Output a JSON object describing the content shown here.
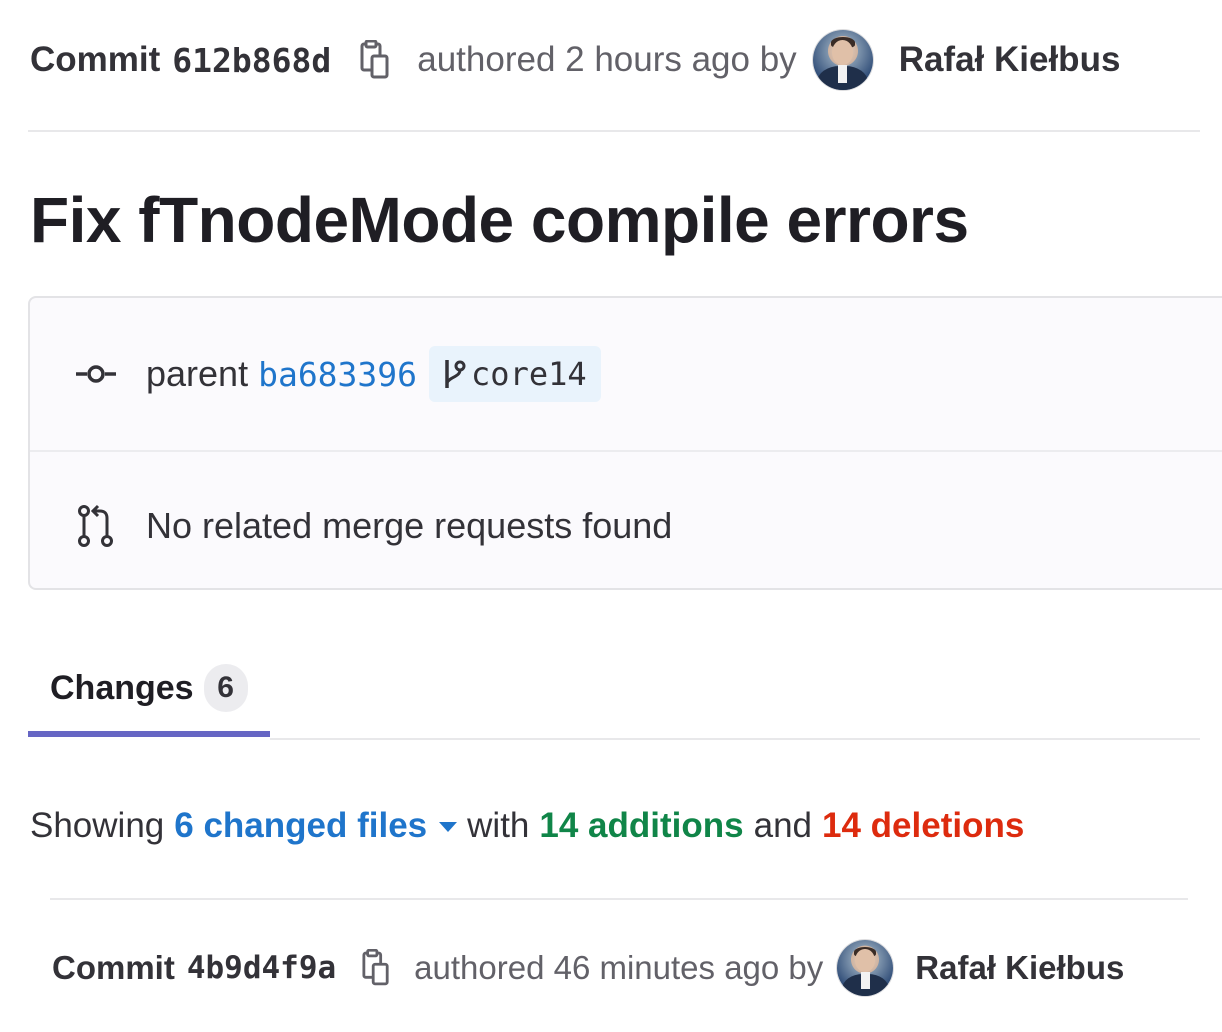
{
  "header": {
    "commit_label": "Commit",
    "sha": "612b868d",
    "authored_text": "authored 2 hours ago by",
    "author": "Rafał Kiełbus",
    "copy_icon": "copy-icon",
    "avatar_icon": "avatar"
  },
  "title": "Fix fTnodeMode compile errors",
  "info": {
    "parent_label": "parent",
    "parent_sha": "ba683396",
    "branch": "core14",
    "merge_text": "No related merge requests found",
    "commit_icon": "commit-node-icon",
    "branch_icon": "branch-icon",
    "merge_icon": "merge-request-icon"
  },
  "tabs": {
    "changes_label": "Changes",
    "changes_count": "6"
  },
  "summary": {
    "showing": "Showing",
    "files": "6 changed files",
    "with": "with",
    "additions": "14 additions",
    "and": "and",
    "deletions": "14 deletions",
    "colors": {
      "link": "#1f75cb",
      "additions": "#108548",
      "deletions": "#dd2b0e"
    }
  },
  "next_commit": {
    "commit_label": "Commit",
    "sha": "4b9d4f9a",
    "authored_text": "authored 46 minutes ago by",
    "author": "Rafał Kiełbus"
  }
}
